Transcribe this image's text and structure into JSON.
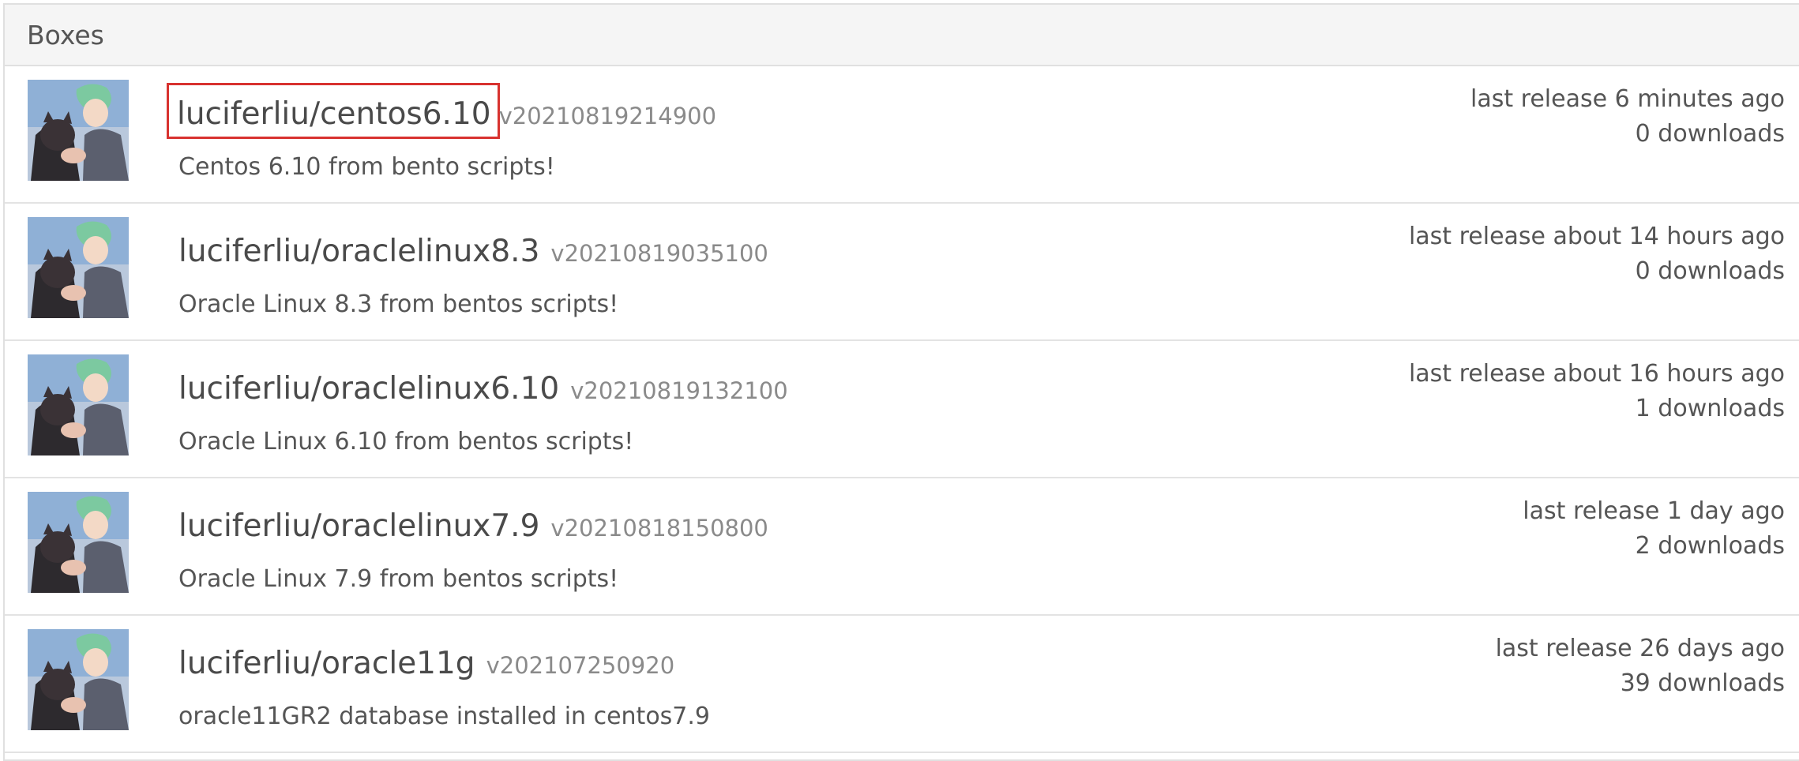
{
  "panel": {
    "title": "Boxes"
  },
  "boxes": [
    {
      "name": "luciferliu/centos6.10",
      "version": "v20210819214900",
      "description": "Centos 6.10 from bento scripts!",
      "last_release": "last release 6 minutes ago",
      "downloads": "0 downloads",
      "highlighted": true
    },
    {
      "name": "luciferliu/oraclelinux8.3",
      "version": "v20210819035100",
      "description": "Oracle Linux 8.3 from bentos scripts!",
      "last_release": "last release about 14 hours ago",
      "downloads": "0 downloads",
      "highlighted": false
    },
    {
      "name": "luciferliu/oraclelinux6.10",
      "version": "v20210819132100",
      "description": "Oracle Linux 6.10 from bentos scripts!",
      "last_release": "last release about 16 hours ago",
      "downloads": "1 downloads",
      "highlighted": false
    },
    {
      "name": "luciferliu/oraclelinux7.9",
      "version": "v20210818150800",
      "description": "Oracle Linux 7.9 from bentos scripts!",
      "last_release": "last release 1 day ago",
      "downloads": "2 downloads",
      "highlighted": false
    },
    {
      "name": "luciferliu/oracle11g",
      "version": "v202107250920",
      "description": "oracle11GR2 database installed in centos7.9",
      "last_release": "last release 26 days ago",
      "downloads": "39 downloads",
      "highlighted": false
    }
  ],
  "colors": {
    "highlight_border": "#d8322f",
    "heading_bg": "#f5f5f5",
    "text": "#555555",
    "version_text": "#8a8a8a"
  }
}
